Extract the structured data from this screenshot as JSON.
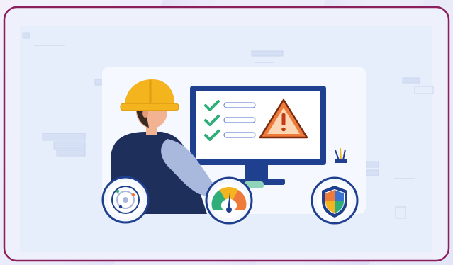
{
  "scene": {
    "subject": "technician-at-computer-monitor",
    "colors": {
      "frame_border": "#8a1f5c",
      "panel_bg": "#e7eefb",
      "monitor_body": "#1f3f8f",
      "screen_bg": "#ffffff",
      "check_green": "#2fae7a",
      "warning_orange": "#ef7b3a",
      "helmet_yellow": "#f4b41e",
      "shirt_navy": "#1f2f5b",
      "sleeve_blue": "#a9b8dd"
    },
    "icons": [
      "checkmark-icon",
      "warning-triangle-icon",
      "radar-icon",
      "gauge-icon",
      "shield-icon"
    ],
    "checklist_items": 3
  }
}
